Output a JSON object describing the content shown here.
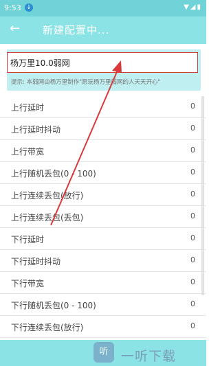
{
  "status": {
    "time": "9:53",
    "download_badge": "↓",
    "right_icons": "▼◢▮"
  },
  "app_bar": {
    "back_icon": "←",
    "title": "新建配置中..."
  },
  "config": {
    "name": "杨万里10.0弱网",
    "tip": "提示: 本弱网由杨万里制作\"愿玩杨万里弱网的人天天开心\""
  },
  "rows": [
    {
      "label": "上行延时",
      "value": "0"
    },
    {
      "label": "上行延时抖动",
      "value": "0"
    },
    {
      "label": "上行带宽",
      "value": "0"
    },
    {
      "label": "上行随机丢包(0 - 100)",
      "value": "0"
    },
    {
      "label": "上行连续丢包(放行)",
      "value": "0"
    },
    {
      "label": "上行连续丢包(丢包)",
      "value": "0"
    },
    {
      "label": "下行延时",
      "value": "0"
    },
    {
      "label": "下行延时抖动",
      "value": "0"
    },
    {
      "label": "下行带宽",
      "value": "0"
    },
    {
      "label": "下行随机丢包(0 - 100)",
      "value": "0"
    },
    {
      "label": "下行连续丢包(放行)",
      "value": "0"
    }
  ],
  "watermark": {
    "icon_text": "听",
    "text": "一听下载"
  },
  "colors": {
    "header": "#8ce3e6",
    "highlight": "#d93a3a",
    "accent_strip": "#bfeff1"
  }
}
